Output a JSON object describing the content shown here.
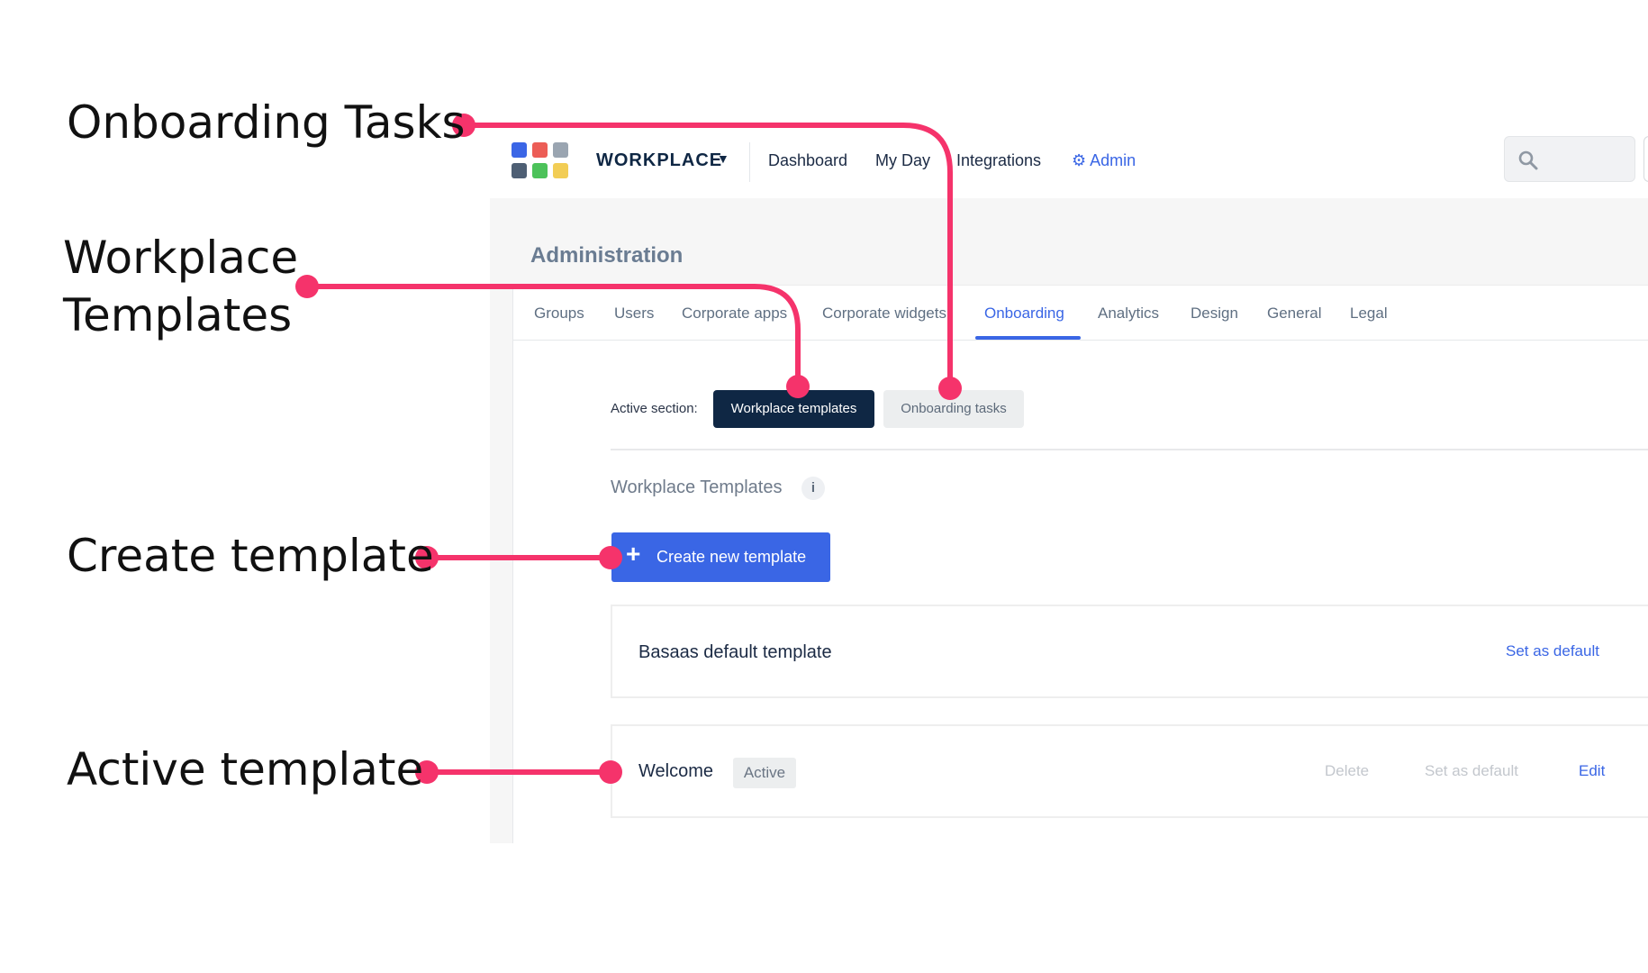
{
  "header": {
    "brand": "WORKPLACE",
    "brand_caret": "▼",
    "nav": [
      "Dashboard",
      "My Day",
      "Integrations"
    ],
    "admin_label": "Admin",
    "search_icon": "search-icon",
    "admin_icon": "gear-icon"
  },
  "logo": {
    "colors": [
      "#3b66e6",
      "#ec5d56",
      "#9aa5b1",
      "#4e5f74",
      "#4cc25a",
      "#f2cd55"
    ]
  },
  "page": {
    "title": "Administration",
    "tabs": [
      {
        "label": "Groups",
        "active": false
      },
      {
        "label": "Users",
        "active": false
      },
      {
        "label": "Corporate apps",
        "active": false
      },
      {
        "label": "Corporate widgets",
        "active": false
      },
      {
        "label": "Onboarding",
        "active": true
      },
      {
        "label": "Analytics",
        "active": false
      },
      {
        "label": "Design",
        "active": false
      },
      {
        "label": "General",
        "active": false
      },
      {
        "label": "Legal",
        "active": false
      }
    ],
    "active_section_label": "Active section:",
    "section_buttons": {
      "primary": "Workplace templates",
      "secondary": "Onboarding tasks"
    },
    "section_title": "Workplace Templates",
    "info_glyph": "i",
    "create_button": {
      "plus": "+",
      "label": "Create new template"
    },
    "templates": [
      {
        "name": "Basaas default template",
        "badge": "",
        "actions": [
          "Set as default"
        ]
      },
      {
        "name": "Welcome",
        "badge": "Active",
        "actions": [
          "Delete",
          "Set as default",
          "Edit"
        ]
      }
    ]
  },
  "annotations": {
    "onboarding_tasks": "Onboarding Tasks",
    "workplace_templates_line1": "Workplace",
    "workplace_templates_line2": "Templates",
    "create_template": "Create template",
    "active_template": "Active template",
    "color": "#f5336b"
  }
}
